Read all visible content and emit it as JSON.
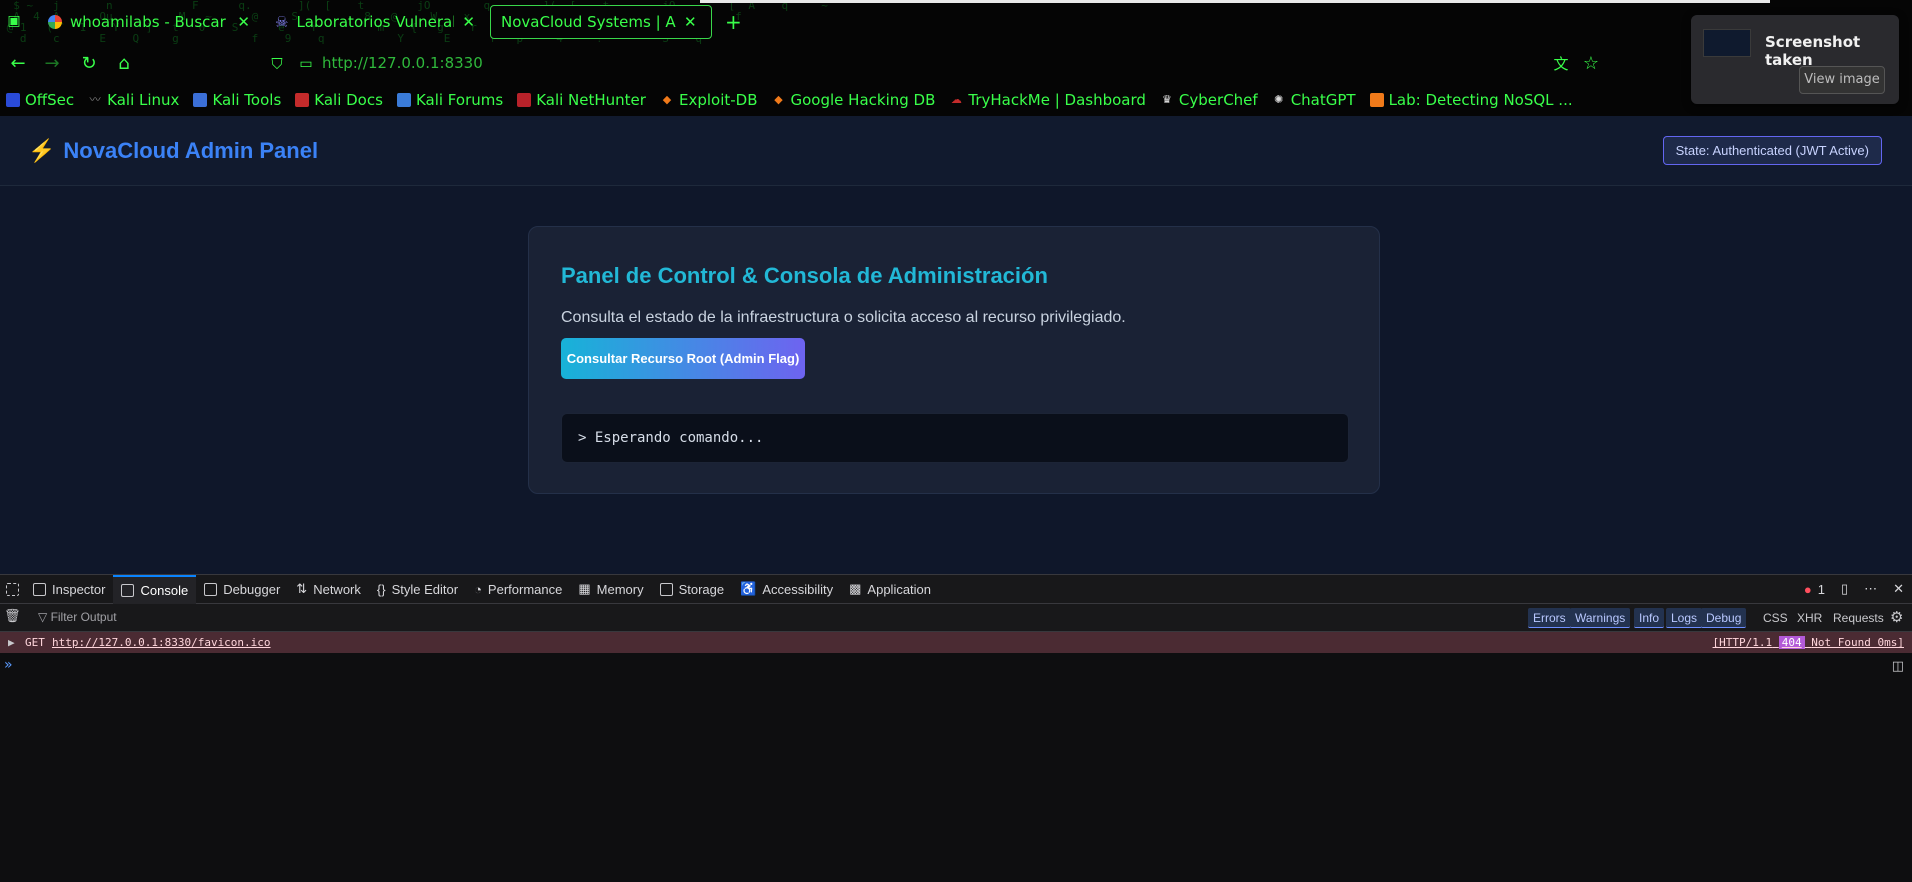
{
  "browser": {
    "tabs": [
      {
        "title": "whoamilabs - Buscar con",
        "close": "✕"
      },
      {
        "title": "Laboratorios Vulnerables",
        "close": "✕"
      },
      {
        "title": "NovaCloud Systems | Admin",
        "close": "✕"
      }
    ],
    "new_tab": "+",
    "url": "http://127.0.0.1:8330",
    "bookmarks": [
      "OffSec",
      "Kali Linux",
      "Kali Tools",
      "Kali Docs",
      "Kali Forums",
      "Kali NetHunter",
      "Exploit-DB",
      "Google Hacking DB",
      "TryHackMe | Dashboard",
      "CyberChef",
      "ChatGPT",
      "Lab: Detecting NoSQL ..."
    ]
  },
  "notification": {
    "title": "Screenshot taken",
    "button": "View image"
  },
  "app": {
    "brand": "NovaCloud Admin Panel",
    "state_badge": "State: Authenticated (JWT Active)",
    "card": {
      "title": "Panel de Control & Consola de Administración",
      "description": "Consulta el estado de la infraestructura o solicita acceso al recurso privilegiado.",
      "button": "Consultar Recurso Root (Admin Flag)",
      "terminal": "> Esperando comando..."
    }
  },
  "devtools": {
    "tabs": [
      "Inspector",
      "Console",
      "Debugger",
      "Network",
      "Style Editor",
      "Performance",
      "Memory",
      "Storage",
      "Accessibility",
      "Application"
    ],
    "error_count": "1",
    "filter_placeholder": "Filter Output",
    "filters": [
      "Errors",
      "Warnings",
      "Info",
      "Logs",
      "Debug",
      "CSS",
      "XHR",
      "Requests"
    ],
    "log": {
      "method": "GET",
      "url": "http://127.0.0.1:8330/favicon.ico",
      "proto": "[HTTP/1.1",
      "status": "404",
      "status_text": "Not Found 0ms]"
    }
  },
  "colors": {
    "accent_green": "#39ff4a",
    "brand_blue": "#3b82f6",
    "title_cyan": "#22b8d6"
  }
}
